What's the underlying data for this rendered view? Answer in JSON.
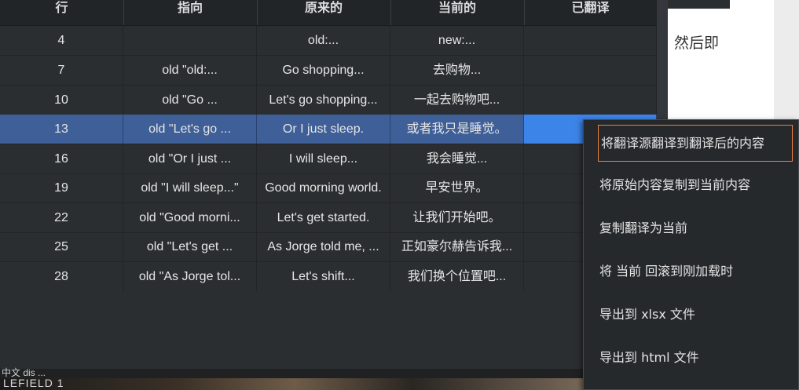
{
  "table": {
    "columns": [
      "行",
      "指向",
      "原来的",
      "当前的",
      "已翻译"
    ],
    "rows": [
      {
        "line": "4",
        "dir": "",
        "orig": "old:...",
        "cur": "new:..."
      },
      {
        "line": "7",
        "dir": "old \"old:...",
        "orig": "Go shopping...",
        "cur": "去购物..."
      },
      {
        "line": "10",
        "dir": "old \"Go ...",
        "orig": "Let's go shopping...",
        "cur": "一起去购物吧..."
      },
      {
        "line": "13",
        "dir": "old \"Let's go ...",
        "orig": "Or I just sleep.",
        "cur": "或者我只是睡觉。"
      },
      {
        "line": "16",
        "dir": "old \"Or I just ...",
        "orig": "I will sleep...",
        "cur": "我会睡觉..."
      },
      {
        "line": "19",
        "dir": "old \"I will sleep...\"",
        "orig": "Good morning world.",
        "cur": "早安世界。"
      },
      {
        "line": "22",
        "dir": "old \"Good morni...",
        "orig": "Let's get started.",
        "cur": "让我们开始吧。"
      },
      {
        "line": "25",
        "dir": "old \"Let's get ...",
        "orig": "As Jorge told me, ...",
        "cur": "正如豪尔赫告诉我..."
      },
      {
        "line": "28",
        "dir": "old \"As Jorge tol...",
        "orig": "Let's shift...",
        "cur": "我们换个位置吧..."
      }
    ],
    "selected_line": "13"
  },
  "side_doc": {
    "snippet": "然后即"
  },
  "bottom": {
    "strip_text": "LEFIELD 1",
    "left_text": "中文  dis  ..."
  },
  "context_menu": {
    "items": [
      "将翻译源翻译到翻译后的内容",
      "将原始内容复制到当前内容",
      "复制翻译为当前",
      "将 当前 回滚到刚加载时",
      "导出到 xlsx 文件",
      "导出到 html 文件"
    ],
    "focused_index": 0
  },
  "colors": {
    "background": "#2b2e31",
    "header": "#222528",
    "selected_row": "#3e5f97",
    "selected_done_cell": "#3d84e8",
    "menu_focus_border": "#f0813b"
  }
}
